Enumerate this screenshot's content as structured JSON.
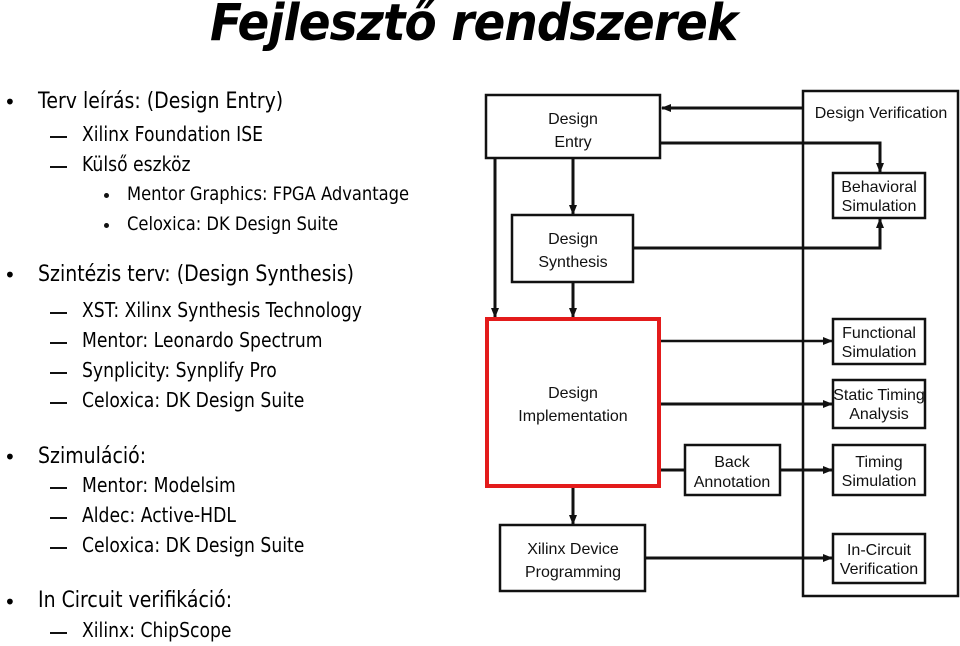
{
  "title": "Fejlesztő rendszerek",
  "sections": [
    {
      "label": "Terv leírás: (Design Entry)",
      "items": [
        {
          "label": "Xilinx Foundation ISE"
        },
        {
          "label": "Külső eszköz",
          "subitems": [
            "Mentor Graphics: FPGA Advantage",
            "Celoxica: DK Design Suite"
          ]
        }
      ]
    },
    {
      "label": "Szintézis terv: (Design Synthesis)",
      "items": [
        {
          "label": "XST: Xilinx Synthesis Technology"
        },
        {
          "label": "Mentor: Leonardo Spectrum"
        },
        {
          "label": "Synplicity: Synplify Pro"
        },
        {
          "label": "Celoxica: DK Design Suite"
        }
      ]
    },
    {
      "label": "Szimuláció:",
      "items": [
        {
          "label": "Mentor: Modelsim"
        },
        {
          "label": "Aldec: Active-HDL"
        },
        {
          "label": "Celoxica: DK Design Suite"
        }
      ]
    },
    {
      "label": "In Circuit verifikáció:",
      "items": [
        {
          "label": "Xilinx: ChipScope"
        }
      ]
    }
  ],
  "diagram": {
    "highlight_color": "#e31b1b",
    "boxes": {
      "design_entry": [
        "Design",
        "Entry"
      ],
      "design_synthesis": [
        "Design",
        "Synthesis"
      ],
      "design_implementation": [
        "Design",
        "Implementation"
      ],
      "xilinx_device_programming": [
        "Xilinx Device",
        "Programming"
      ],
      "back_annotation": [
        "Back",
        "Annotation"
      ],
      "design_verification": "Design Verification",
      "behavioral_simulation": [
        "Behavioral",
        "Simulation"
      ],
      "functional_simulation": [
        "Functional",
        "Simulation"
      ],
      "static_timing_analysis": [
        "Static Timing",
        "Analysis"
      ],
      "timing_simulation": [
        "Timing",
        "Simulation"
      ],
      "in_circuit_verification": [
        "In-Circuit",
        "Verification"
      ]
    }
  }
}
